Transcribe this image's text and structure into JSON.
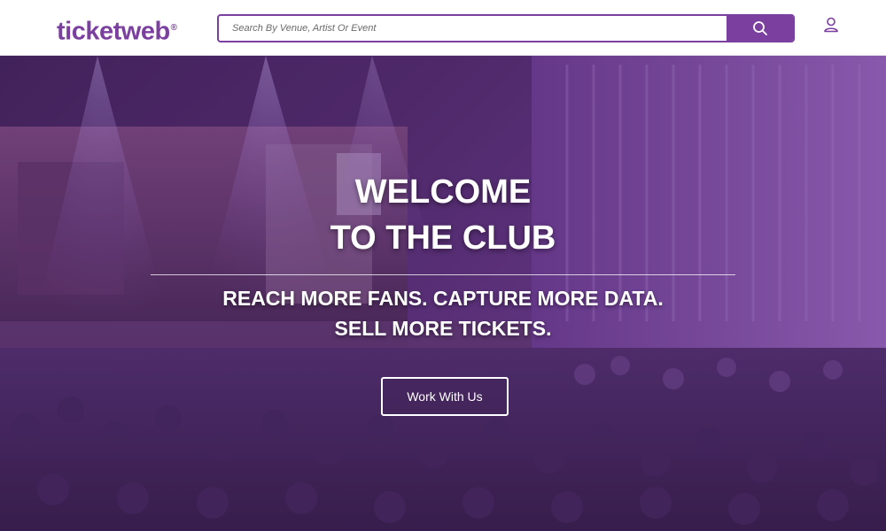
{
  "header": {
    "logo_text": "ticketweb",
    "logo_mark": "®",
    "search": {
      "placeholder": "Search By Venue, Artist Or Event",
      "value": "",
      "button_icon": "search-icon"
    },
    "account_icon": "user-icon"
  },
  "hero": {
    "title_line1": "WELCOME",
    "title_line2": "TO THE CLUB",
    "subtitle_line1": "REACH MORE FANS. CAPTURE MORE DATA.",
    "subtitle_line2": "SELL MORE TICKETS.",
    "cta_label": "Work With Us",
    "background": "concert-crowd-photo"
  },
  "colors": {
    "brand": "#7b3fa0",
    "hero_tint": "#5a2a7a",
    "text_on_hero": "#ffffff"
  }
}
